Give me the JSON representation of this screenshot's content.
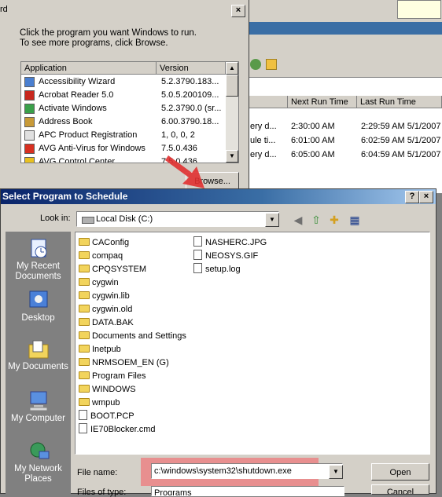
{
  "background_window": {
    "list_headers": [
      "Next Run Time",
      "Last Run Time"
    ],
    "rows": [
      {
        "col1": "ery d...",
        "next_run": "2:30:00 AM",
        "last_run": "2:29:59 AM  5/1/2007"
      },
      {
        "col1": "ule ti...",
        "next_run": "6:01:00 AM",
        "last_run": "6:02:59 AM  5/1/2007"
      },
      {
        "col1": "ery d...",
        "next_run": "6:05:00 AM",
        "last_run": "6:04:59 AM  5/1/2007"
      }
    ]
  },
  "run_dialog": {
    "title": "rd",
    "close_symbol": "×",
    "instruction_line1": "Click the program you want Windows to run.",
    "instruction_line2": "To see more programs, click Browse.",
    "headers": {
      "application": "Application",
      "version": "Version"
    },
    "programs": [
      {
        "name": "Accessibility Wizard",
        "version": "5.2.3790.183...",
        "icon_color": "#4a7fd0"
      },
      {
        "name": "Acrobat Reader 5.0",
        "version": "5.0.5.200109...",
        "icon_color": "#c8281e"
      },
      {
        "name": "Activate Windows",
        "version": "5.2.3790.0 (sr...",
        "icon_color": "#3aa04a"
      },
      {
        "name": "Address Book",
        "version": "6.00.3790.18...",
        "icon_color": "#c89a38"
      },
      {
        "name": "APC Product Registration",
        "version": "1, 0, 0, 2",
        "icon_color": "#e0e0e0"
      },
      {
        "name": "AVG Anti-Virus for Windows",
        "version": "7.5.0.436",
        "icon_color": "#d83020"
      },
      {
        "name": "AVG Control Center",
        "version": "7.5.0.436",
        "icon_color": "#e8c020"
      }
    ],
    "browse_label": "Browse..."
  },
  "select_dialog": {
    "title": "Select Program to Schedule",
    "help_symbol": "?",
    "close_symbol": "×",
    "look_in_label": "Look in:",
    "look_in_value": "Local Disk (C:)",
    "places": [
      "My Recent Documents",
      "Desktop",
      "My Documents",
      "My Computer",
      "My Network Places"
    ],
    "folders": [
      "CAConfig",
      "compaq",
      "CPQSYSTEM",
      "cygwin",
      "cygwin.lib",
      "cygwin.old",
      "DATA.BAK",
      "Documents and Settings",
      "Inetpub",
      "NRMSOEM_EN (G)",
      "Program Files",
      "WINDOWS",
      "wmpub"
    ],
    "files_col1": [
      "BOOT.PCP",
      "IE70Blocker.cmd"
    ],
    "files_col2": [
      "NASHERC.JPG",
      "NEOSYS.GIF",
      "setup.log"
    ],
    "file_name_label": "File name:",
    "file_name_value": "c:\\windows\\system32\\shutdown.exe",
    "files_of_type_label": "Files of type:",
    "files_of_type_value": "Programs",
    "open_label": "Open",
    "cancel_label": "Cancel"
  },
  "colors": {
    "highlight": "#e88f8f",
    "titlebar_start": "#0a246a",
    "arrow": "#e03030"
  }
}
